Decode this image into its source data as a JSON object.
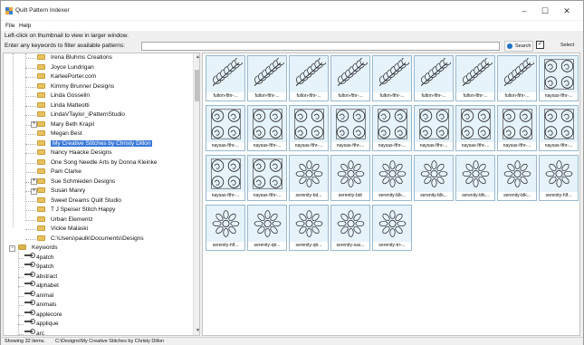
{
  "window": {
    "title": "Quilt Pattern Indexer",
    "controls": {
      "minimize": "–",
      "maximize": "☐",
      "close": "✕"
    }
  },
  "menu": [
    "File",
    "Help"
  ],
  "hint": "Left-click on thumbnail to view in larger window.",
  "filter": {
    "label": "Enter any keywords to filter available patterns:",
    "value": "",
    "search_label": "Search",
    "select_label": "Select",
    "select_checked": true
  },
  "tree": {
    "designers": [
      "Irena Bluhms Creations",
      "Joyce Lundrigan",
      "KarleePorter.com",
      "Kimmy Brunner Designs",
      "Linda Gosselin",
      "Linda Matteotti",
      "LindaVTaylor_iPatternStudio",
      "Mary Beth Krapil",
      "Megan Best",
      "My Creative Stitches by Christy Dillon",
      "Nancy Haacke Designs",
      "One Song Needle Arts by Donna Kleinke",
      "Pam Clarke",
      "Sue Schmieden Designs",
      "Susan Manry",
      "Sweet Dreams Quilt Studio",
      "T J Speiser Stitch Happy",
      "Urban Elementz",
      "Vickie Malaski"
    ],
    "expandable": [
      "Mary Beth Krapil",
      "Sue Schmieden Designs",
      "Susan Manry"
    ],
    "selected": "My Creative Stitches by Christy Dillon",
    "root_path": "C:\\Users\\paulk\\Documents\\Designs",
    "keywords_label": "Keywords",
    "keywords": [
      "4patch",
      "9patch",
      "abstract",
      "alphabet",
      "animal",
      "animals",
      "applecore",
      "applique",
      "arc"
    ]
  },
  "thumbnails": [
    "fulton-fthr-...",
    "fulton-fthr-...",
    "fulton-fthr-...",
    "fulton-fthr-...",
    "fulton-fthr-...",
    "fulton-fthr-...",
    "fulton-fthr-...",
    "fulton-fthr-...",
    "naysas-fthr-...",
    "naysas-fthr-...",
    "naysas-fthr-...",
    "naysas-fthr-...",
    "naysas-fthr-...",
    "naysas-fthr-...",
    "naysas-fthr-...",
    "naysas-fthr-...",
    "naysas-fthr-...",
    "naysas-fthr-...",
    "naysas-fthr-...",
    "naysas-fthr-...",
    "serenity-bd...",
    "serenity-bdr",
    "serenity-blk...",
    "serenity-blk...",
    "serenity-blk...",
    "serenity-blk...",
    "serenity-hlf...",
    "serenity-hlf...",
    "serenity-qtr...",
    "serenity-qtr...",
    "serenity-sas...",
    "serenity-tri-..."
  ],
  "status": {
    "count": "Showing 32 items.",
    "path": "C:\\Designs\\My Creative Stitches by Christy Dillon"
  },
  "colors": {
    "selection": "#3a78d8",
    "thumb_bg": "#e6f3fb",
    "thumb_border": "#98b8cf",
    "folder": "#e8c25f"
  }
}
